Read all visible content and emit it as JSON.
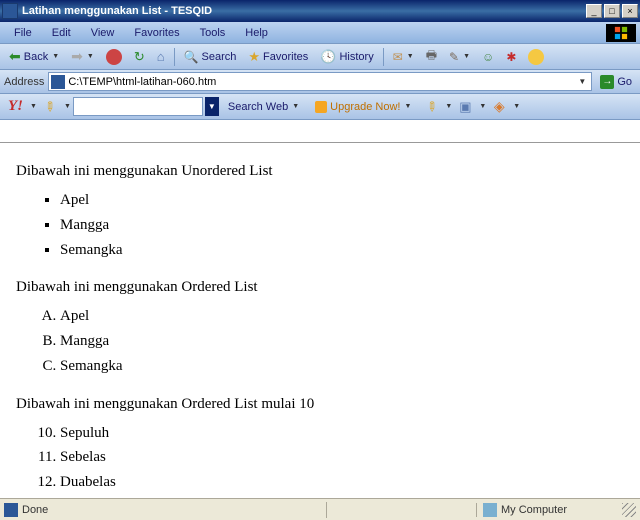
{
  "window": {
    "title": "Latihan menggunakan List - TESQID",
    "min": "_",
    "max": "□",
    "close": "×"
  },
  "menubar": {
    "items": [
      "File",
      "Edit",
      "View",
      "Favorites",
      "Tools",
      "Help"
    ]
  },
  "toolbar": {
    "back": "Back",
    "search": "Search",
    "favorites": "Favorites",
    "history": "History"
  },
  "address": {
    "label": "Address",
    "value": "C:\\TEMP\\html-latihan-060.htm",
    "go": "Go"
  },
  "yahoo": {
    "logo": "Y!",
    "search_value": "",
    "search_web": "Search Web",
    "upgrade": "Upgrade Now!"
  },
  "content": {
    "p1": "Dibawah ini menggunakan Unordered List",
    "ul": [
      "Apel",
      "Mangga",
      "Semangka"
    ],
    "p2": "Dibawah ini menggunakan Ordered List",
    "ol_alpha": [
      "Apel",
      "Mangga",
      "Semangka"
    ],
    "p3": "Dibawah ini menggunakan Ordered List mulai 10",
    "ol_start": 10,
    "ol_dec": [
      "Sepuluh",
      "Sebelas",
      "Duabelas"
    ]
  },
  "status": {
    "done": "Done",
    "zone": "My Computer"
  }
}
